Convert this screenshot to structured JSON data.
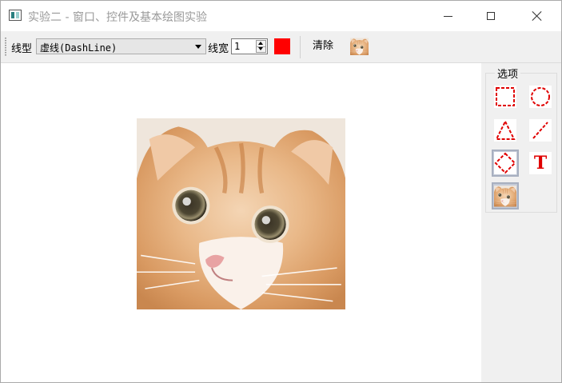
{
  "window": {
    "title": "实验二 - 窗口、控件及基本绘图实验"
  },
  "toolbar": {
    "line_type_label": "线型",
    "line_type_value": "虚线(DashLine)",
    "line_width_label": "线宽",
    "line_width_value": "1",
    "pen_color": "#ff0000",
    "clear_label": "清除",
    "image_button_icon": "cat-image-icon"
  },
  "dock": {
    "group_title": "选项",
    "tools": [
      {
        "icon": "dashed-rectangle-icon",
        "checked": false
      },
      {
        "icon": "dashed-circle-icon",
        "checked": false
      },
      {
        "icon": "dashed-triangle-icon",
        "checked": false
      },
      {
        "icon": "dashed-line-icon",
        "checked": false
      },
      {
        "icon": "dashed-diamond-icon",
        "checked": true
      },
      {
        "icon": "text-icon",
        "checked": false,
        "glyph": "T"
      },
      {
        "icon": "cat-image-icon",
        "checked": true
      }
    ]
  },
  "colors": {
    "accent_red": "#e00000",
    "toolbar_bg": "#f0f0f0",
    "checked_tool_bg": "#c4cbd8"
  }
}
